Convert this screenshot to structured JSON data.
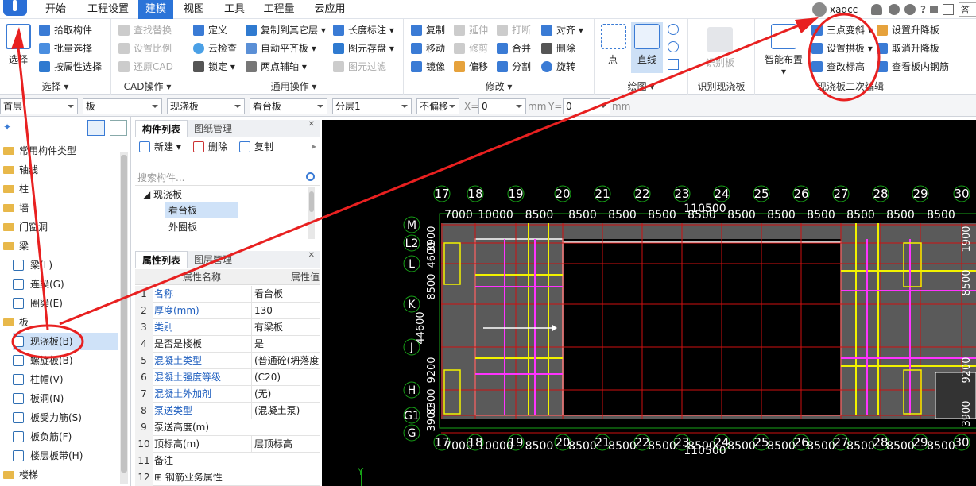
{
  "menubar": {
    "items": [
      "开始",
      "工程设置",
      "建模",
      "视图",
      "工具",
      "工程量",
      "云应用"
    ],
    "active": "建模",
    "user": "xagcc",
    "help": "?",
    "search_partial": "答疑"
  },
  "ribbon": {
    "select": {
      "big": "选择",
      "btns": [
        "拾取构件",
        "批量选择",
        "按属性选择"
      ],
      "title": "选择"
    },
    "cad": {
      "btns": [
        "查找替换",
        "设置比例",
        "还原CAD"
      ],
      "title": "CAD操作"
    },
    "common": {
      "col1": [
        "定义",
        "云检查",
        "锁定"
      ],
      "col2": [
        "复制到其它层",
        "自动平齐板",
        "两点辅轴"
      ],
      "col3": [
        "长度标注",
        "图元存盘",
        "图元过滤"
      ],
      "title": "通用操作"
    },
    "modify": {
      "col1": [
        "复制",
        "移动",
        "镜像"
      ],
      "col2": [
        "延伸",
        "修剪",
        "偏移"
      ],
      "col3": [
        "打断",
        "合并",
        "分割"
      ],
      "col4": [
        "对齐",
        "删除",
        "旋转"
      ],
      "title": "修改"
    },
    "draw": {
      "big1": "点",
      "big2": "直线",
      "title": "绘图"
    },
    "recognize": {
      "big": "识别板",
      "title": "识别现浇板"
    },
    "slab2": {
      "big": "智能布置",
      "col1": [
        "三点变斜",
        "设置拱板",
        "查改标高"
      ],
      "col2": [
        "设置升降板",
        "取消升降板",
        "查看板内钢筋"
      ],
      "title": "现浇板二次编辑"
    }
  },
  "propbar": {
    "floor": "首层",
    "type": "板",
    "subtype": "现浇板",
    "member": "看台板",
    "layer": "分层1",
    "offset": "不偏移",
    "x_label": "X=",
    "x_value": "0",
    "y_label": "Y=",
    "y_value": "0",
    "unit": "mm"
  },
  "tree": {
    "items": [
      {
        "label": "常用构件类型",
        "kind": "folder"
      },
      {
        "label": "轴线",
        "kind": "folder"
      },
      {
        "label": "柱",
        "kind": "folder"
      },
      {
        "label": "墙",
        "kind": "folder"
      },
      {
        "label": "门窗洞",
        "kind": "folder"
      },
      {
        "label": "梁",
        "kind": "folder"
      },
      {
        "label": "梁(L)",
        "kind": "child"
      },
      {
        "label": "连梁(G)",
        "kind": "child"
      },
      {
        "label": "圈梁(E)",
        "kind": "child"
      },
      {
        "label": "板",
        "kind": "folder"
      },
      {
        "label": "现浇板(B)",
        "kind": "child",
        "selected": true
      },
      {
        "label": "螺旋板(B)",
        "kind": "child"
      },
      {
        "label": "柱帽(V)",
        "kind": "child"
      },
      {
        "label": "板洞(N)",
        "kind": "child"
      },
      {
        "label": "板受力筋(S)",
        "kind": "child"
      },
      {
        "label": "板负筋(F)",
        "kind": "child"
      },
      {
        "label": "楼层板带(H)",
        "kind": "child"
      },
      {
        "label": "楼梯",
        "kind": "folder"
      }
    ]
  },
  "component_list": {
    "tabs": [
      "构件列表",
      "图纸管理"
    ],
    "new": "新建",
    "delete": "删除",
    "copy": "复制",
    "search_placeholder": "搜索构件...",
    "group": "现浇板",
    "items": [
      "看台板",
      "外圈板"
    ],
    "selected": "看台板"
  },
  "properties": {
    "tabs": [
      "属性列表",
      "图层管理"
    ],
    "col_name": "属性名称",
    "col_value": "属性值",
    "rows": [
      {
        "n": "1",
        "k": "名称",
        "v": "看台板",
        "blue": true
      },
      {
        "n": "2",
        "k": "厚度(mm)",
        "v": "130",
        "blue": true
      },
      {
        "n": "3",
        "k": "类别",
        "v": "有梁板",
        "blue": true
      },
      {
        "n": "4",
        "k": "是否是楼板",
        "v": "是",
        "blue": false
      },
      {
        "n": "5",
        "k": "混凝土类型",
        "v": "(普通砼(坍落度",
        "blue": true
      },
      {
        "n": "6",
        "k": "混凝土强度等级",
        "v": "(C20)",
        "blue": true
      },
      {
        "n": "7",
        "k": "混凝土外加剂",
        "v": "(无)",
        "blue": true
      },
      {
        "n": "8",
        "k": "泵送类型",
        "v": "(混凝土泵)",
        "blue": true
      },
      {
        "n": "9",
        "k": "泵送高度(m)",
        "v": "",
        "blue": false
      },
      {
        "n": "10",
        "k": "顶标高(m)",
        "v": "层顶标高",
        "blue": false
      },
      {
        "n": "11",
        "k": "备注",
        "v": "",
        "blue": false
      },
      {
        "n": "12",
        "k": "钢筋业务属性",
        "v": "",
        "blue": false
      }
    ]
  },
  "drawing": {
    "axes_x": [
      "17",
      "18",
      "19",
      "20",
      "21",
      "22",
      "23",
      "24",
      "25",
      "26",
      "27",
      "28",
      "29",
      "30"
    ],
    "dims_x": [
      "7000",
      "10000",
      "8500",
      "8500",
      "8500",
      "8500",
      "8500",
      "8500",
      "8500",
      "8500",
      "8500",
      "8500",
      "8500"
    ],
    "total_x": "110500",
    "axes_y": [
      "M",
      "L2",
      "L",
      "K",
      "J",
      "H",
      "G1",
      "G"
    ],
    "left_dims": [
      "3900",
      "4600",
      "8500",
      "44600",
      "9200",
      "8300",
      "3900"
    ],
    "right_dims_top": "1900",
    "right_dims_mid": "8500",
    "right_dims_low": "9200",
    "right_dims_bottom": "3900",
    "y_axis_marker": "Y",
    "colors": {
      "grid": "#d01010",
      "axis": "#17a317",
      "slab": "#5a5a5a",
      "yellow": "#f2f200",
      "magenta": "#ff33ff",
      "white": "#ffffff"
    }
  },
  "annotations": {
    "color": "#e82020"
  }
}
